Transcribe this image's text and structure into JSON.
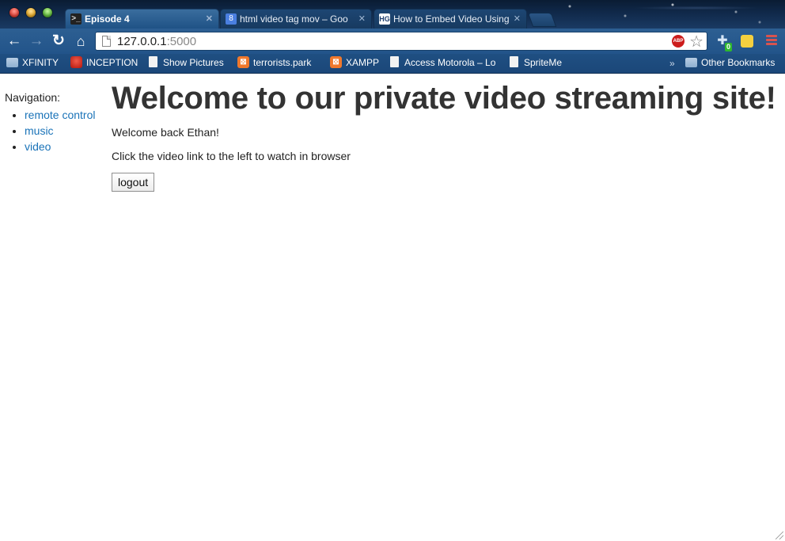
{
  "browser": {
    "tabs": [
      {
        "label": "Episode 4",
        "favicon": "terminal-icon",
        "active": true
      },
      {
        "label": "html video tag mov – Goo",
        "favicon": "google-icon",
        "active": false
      },
      {
        "label": "How to Embed Video Using",
        "favicon": "hg-icon",
        "active": false
      }
    ],
    "address": {
      "host": "127.0.0.1",
      "port": ":5000"
    },
    "extensions": {
      "abp_label": "ABP",
      "badge_count": "0"
    },
    "bookmarks": [
      {
        "label": "XFINITY",
        "icon": "folder-icon"
      },
      {
        "label": "INCEPTION",
        "icon": "red-app-icon"
      },
      {
        "label": "Show Pictures",
        "icon": "page-icon"
      },
      {
        "label": "terrorists.park",
        "icon": "xampp-icon"
      },
      {
        "label": "XAMPP",
        "icon": "xampp-icon"
      },
      {
        "label": "Access Motorola – Lo",
        "icon": "page-icon"
      },
      {
        "label": "SpriteMe",
        "icon": "page-icon"
      }
    ],
    "other_bookmarks": "Other Bookmarks",
    "chevron": "»"
  },
  "page": {
    "nav_heading": "Navigation:",
    "nav_links": [
      "remote control",
      "music",
      "video"
    ],
    "title": "Welcome to our private video streaming site!",
    "welcome_text": "Welcome back Ethan!",
    "instruction_text": "Click the video link to the left to watch in browser",
    "logout_label": "logout"
  },
  "colors": {
    "link": "#1a73b8",
    "heading": "#333333",
    "toolbar": "#22548a"
  }
}
